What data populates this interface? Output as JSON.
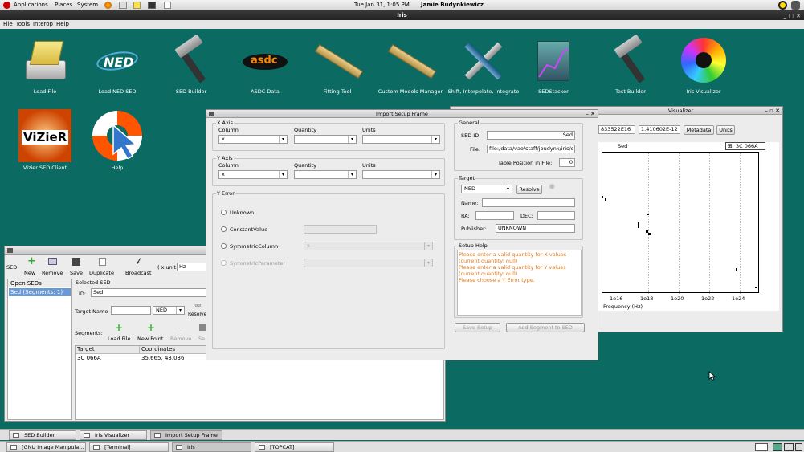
{
  "top_panel": {
    "menus": [
      "Applications",
      "Places",
      "System"
    ],
    "clock": "Tue Jan 31,  1:05 PM",
    "user": "Jamie Budynkiewicz"
  },
  "iris_window": {
    "title": "Iris",
    "menu": [
      "File",
      "Tools",
      "Interop",
      "Help"
    ]
  },
  "desktop_icons": [
    {
      "label": "Load File",
      "icon": "folder-drive-icon"
    },
    {
      "label": "Load NED SED",
      "icon": "ned-logo-icon"
    },
    {
      "label": "SED Builder",
      "icon": "hammer-icon"
    },
    {
      "label": "ASDC Data",
      "icon": "asdc-logo-icon"
    },
    {
      "label": "Fitting Tool",
      "icon": "ruler-icon"
    },
    {
      "label": "Custom Models Manager",
      "icon": "ruler-icon"
    },
    {
      "label": "Shift, Interpolate, Integrate",
      "icon": "wrench-screwdriver-icon"
    },
    {
      "label": "SEDStacker",
      "icon": "chart-icon"
    },
    {
      "label": "Test Builder",
      "icon": "hammer-icon"
    },
    {
      "label": "Iris Visualizer",
      "icon": "color-wheel-icon"
    },
    {
      "label": "Vizier SED Client",
      "icon": "vizier-logo-icon"
    },
    {
      "label": "Help",
      "icon": "lifebuoy-cursor-icon"
    }
  ],
  "import_setup": {
    "title": "Import Setup Frame",
    "x_axis": {
      "title": "X Axis",
      "col_label": "Column",
      "qty_label": "Quantity",
      "units_label": "Units",
      "column": "x",
      "quantity": "",
      "units": ""
    },
    "y_axis": {
      "title": "Y Axis",
      "col_label": "Column",
      "qty_label": "Quantity",
      "units_label": "Units",
      "column": "x",
      "quantity": "",
      "units": ""
    },
    "y_error": {
      "title": "Y Error",
      "options": [
        "Unknown",
        "ConstantValue",
        "SymmetricColumn",
        "SymmetricParameter"
      ],
      "symmetric_column_value": "x"
    },
    "general": {
      "title": "General",
      "sed_id_label": "SED ID:",
      "sed_id": "Sed",
      "file_label": "File:",
      "file": "file:/data/vao/staff/jbudynk/iris/c",
      "table_pos_label": "Table Position in File:",
      "table_pos": "0"
    },
    "target": {
      "title": "Target",
      "source": "NED",
      "resolve": "Resolve",
      "name_label": "Name:",
      "name": "",
      "ra_label": "RA:",
      "ra": "",
      "dec_label": "DEC:",
      "dec": "",
      "publisher_label": "Publisher:",
      "publisher": "UNKNOWN"
    },
    "help": {
      "title": "Setup Help",
      "lines": [
        "Please enter a valid quantity for X values",
        "(current quantity: null)",
        "Please enter a valid quantity for Y values",
        "(current quantity: null)",
        "Please choose a Y Error type."
      ]
    },
    "save_setup": "Save Setup",
    "add_segment": "Add Segment to SED"
  },
  "visualizer": {
    "title": "Visualizer",
    "field1": "833522E16",
    "field2": "1.410602E-12",
    "metadata_btn": "Metadata",
    "units_btn": "Units",
    "plot_title": "Sed",
    "legend": "3C 066A",
    "xlabel": "Frequency (Hz)",
    "xticks": [
      "1e16",
      "1e18",
      "1e20",
      "1e22",
      "1e24"
    ]
  },
  "sed_builder": {
    "sed_label": "SED:",
    "toolbar": [
      "New",
      "Remove",
      "Save",
      "Duplicate",
      "Broadcast"
    ],
    "xunit_label": "( x unit:",
    "xunit": "Hz",
    "open_seds_title": "Open SEDs",
    "open_sed_item": "Sed (Segments: 1)",
    "selected_sed_title": "Selected SED",
    "id_label": "ID:",
    "id_value": "Sed",
    "target_name_label": "Target Name",
    "target_source": "NED",
    "resolve": "Resolve",
    "segments_label": "Segments:",
    "seg_toolbar": [
      "Load File",
      "New Point",
      "Remove",
      "Sa"
    ],
    "table_headers": [
      "Target",
      "Coordinates"
    ],
    "table_rows": [
      [
        "3C 066A",
        "35.665, 43.036"
      ]
    ]
  },
  "taskbar1": [
    "SED Builder",
    "Iris Visualizer",
    "Import Setup Frame"
  ],
  "taskbar2": [
    "[GNU Image Manipula...",
    "[Terminal]",
    "Iris",
    "[TOPCAT]"
  ]
}
